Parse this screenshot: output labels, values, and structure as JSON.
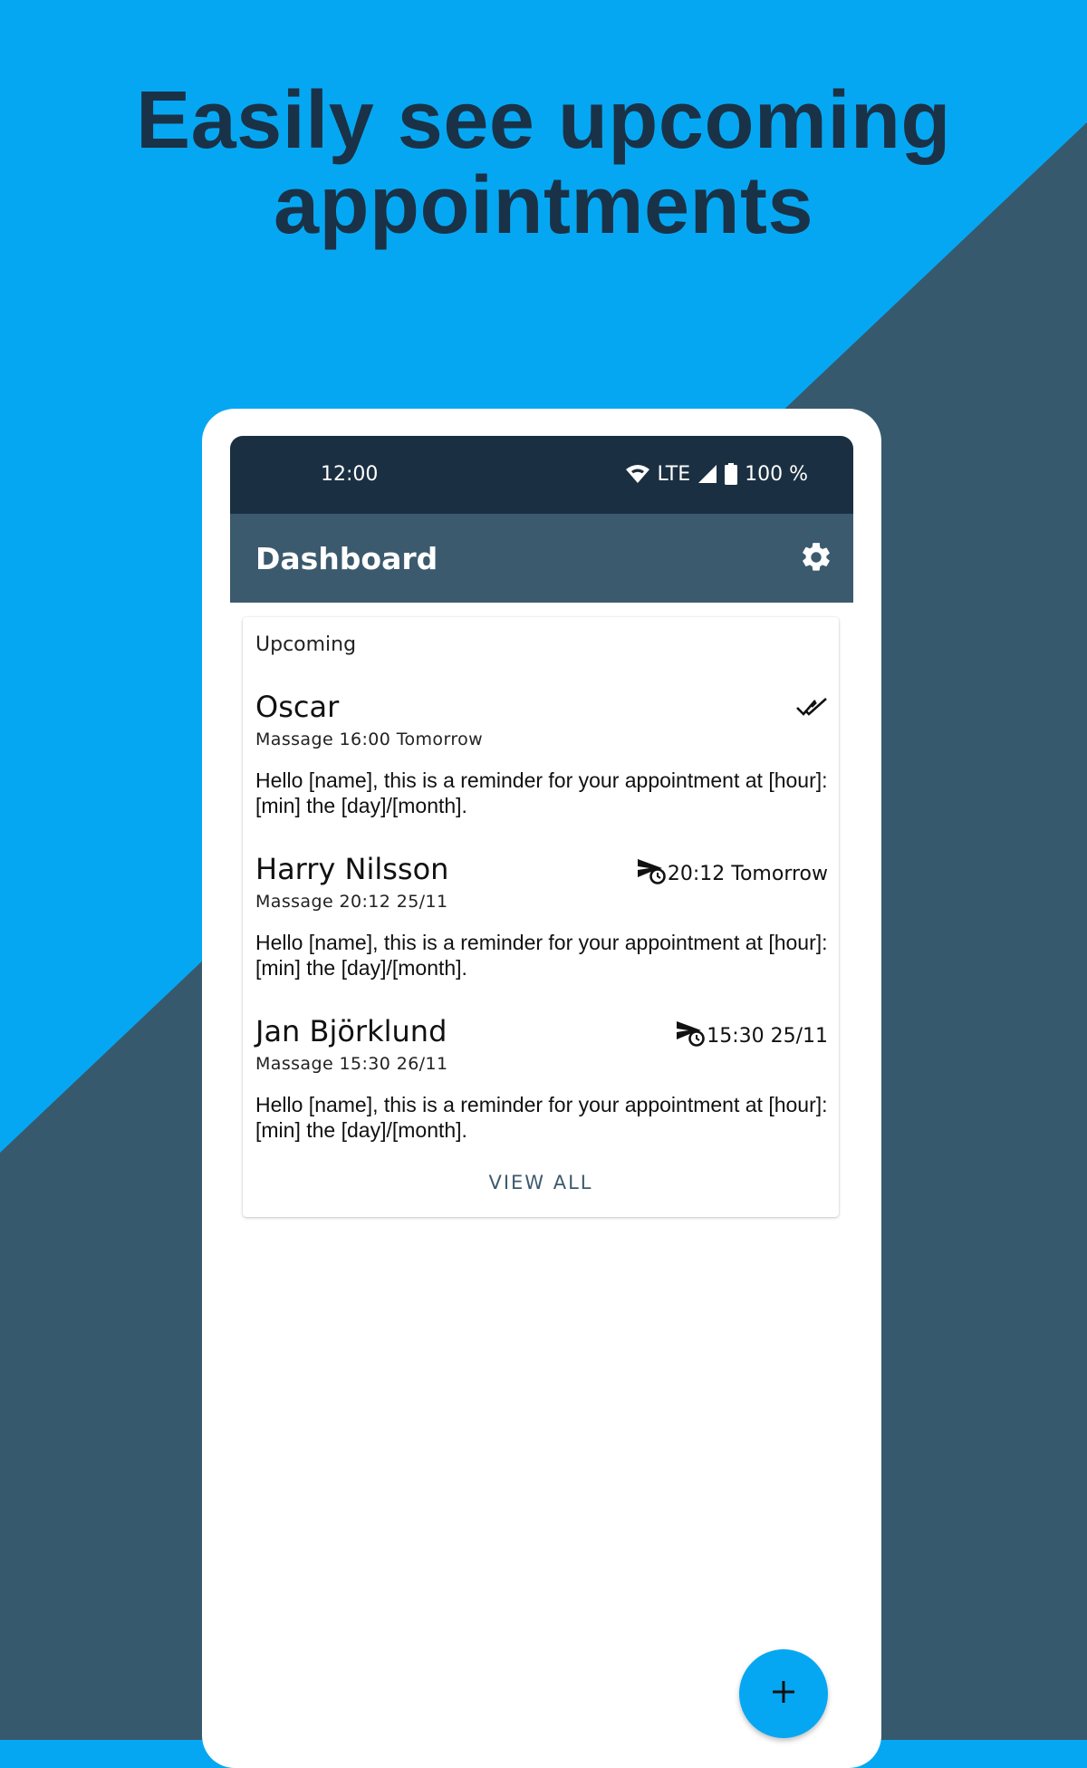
{
  "headline": {
    "line1": "Easily see upcoming",
    "line2": "appointments"
  },
  "colors": {
    "background_light": "#06a7f2",
    "background_dark": "#37596e",
    "headline": "#1a3247",
    "status_bar": "#1b2f42",
    "app_bar": "#3c5a6e",
    "fab": "#06a7f2"
  },
  "status_bar": {
    "time": "12:00",
    "network": "LTE",
    "battery": "100 %",
    "icons": [
      "wifi-icon",
      "cell-signal-icon",
      "battery-icon"
    ]
  },
  "app_bar": {
    "title": "Dashboard",
    "settings_icon": "gear-icon"
  },
  "card": {
    "title": "Upcoming",
    "appointments": [
      {
        "name": "Oscar",
        "service": "Massage",
        "time": "16:00",
        "when": "Tomorrow",
        "status_icon": "double-check-icon",
        "status_text": "",
        "message": "Hello [name], this is a reminder for your appointment at [hour]:[min] the [day]/[month]."
      },
      {
        "name": "Harry Nilsson",
        "service": "Massage",
        "time": "20:12",
        "when": "25/11",
        "status_icon": "scheduled-send-icon",
        "status_text": "20:12 Tomorrow",
        "message": "Hello [name], this is a reminder for your appointment at [hour]:[min] the [day]/[month]."
      },
      {
        "name": "Jan Björklund",
        "service": "Massage",
        "time": "15:30",
        "when": "26/11",
        "status_icon": "scheduled-send-icon",
        "status_text": "15:30 25/11",
        "message": "Hello [name], this is a reminder for your appointment at [hour]:[min] the [day]/[month]."
      }
    ],
    "view_all_label": "VIEW ALL"
  },
  "fab": {
    "icon": "plus-icon"
  }
}
